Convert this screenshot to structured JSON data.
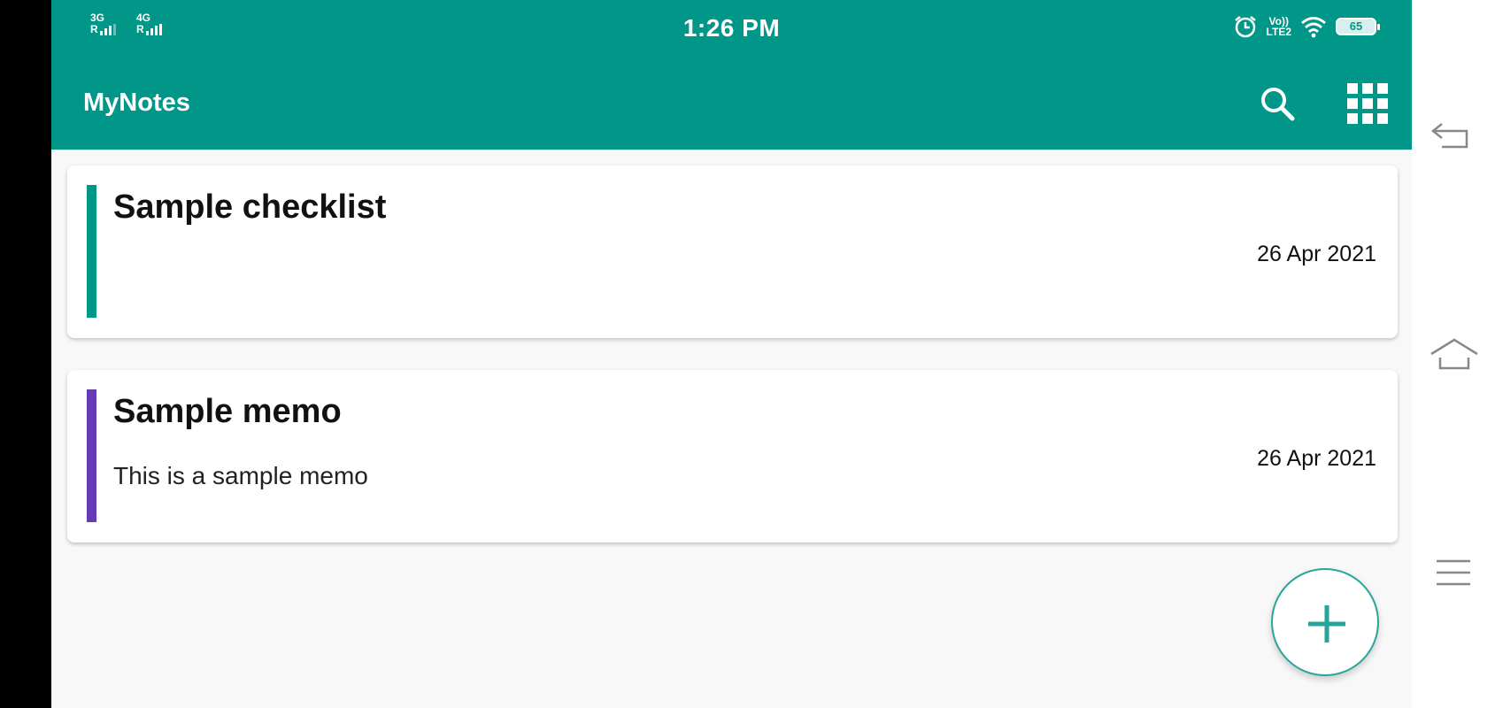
{
  "status_bar": {
    "sim1_label": "3G",
    "sim2_label": "4G",
    "roaming_1": "R",
    "roaming_2": "R",
    "time": "1:26 PM",
    "volte_label": "Vo))",
    "lte_label": "LTE2",
    "battery_level": "65",
    "icons": [
      "signal-icon",
      "alarm-icon",
      "wifi-icon",
      "battery-icon"
    ]
  },
  "app_bar": {
    "title": "MyNotes",
    "actions": [
      "search-icon",
      "grid-view-icon"
    ]
  },
  "notes": [
    {
      "title": "Sample checklist",
      "body": "",
      "date": "26 Apr 2021",
      "accent": "#009688"
    },
    {
      "title": "Sample memo",
      "body": "This is a sample memo",
      "date": "26 Apr 2021",
      "accent": "#673ab7"
    }
  ],
  "fab": {
    "icon": "plus-icon"
  },
  "nav_bar": {
    "buttons": [
      "back-icon",
      "home-icon",
      "menu-icon"
    ]
  },
  "colors": {
    "primary": "#009688",
    "fab_accent": "#26a69a"
  }
}
